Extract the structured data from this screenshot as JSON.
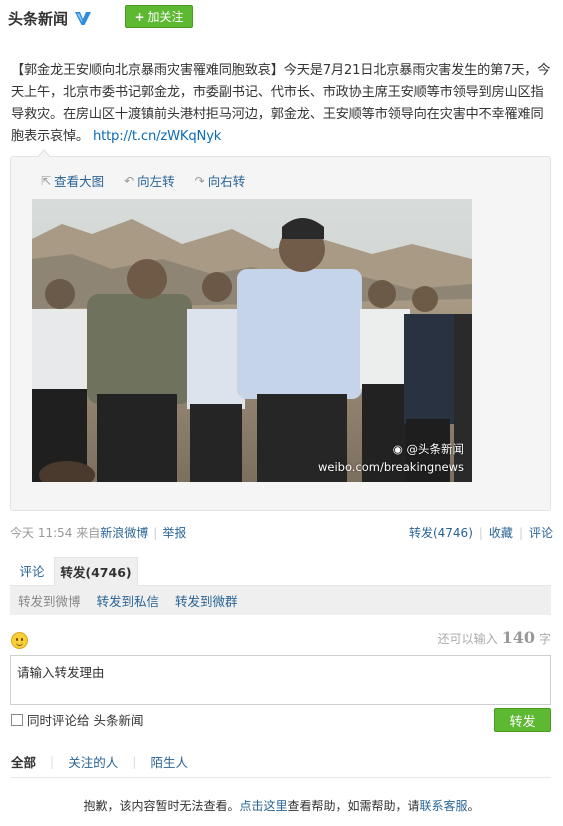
{
  "header": {
    "author": "头条新闻",
    "follow_label": "加关注"
  },
  "post": {
    "text": "【郭金龙王安顺向北京暴雨灾害罹难同胞致哀】今天是7月21日北京暴雨灾害发生的第7天，今天上午，北京市委书记郭金龙，市委副书记、代市长、市政协主席王安顺等市领导到房山区指导救灾。在房山区十渡镇前头港村拒马河边，郭金龙、王安顺等市领导向在灾害中不幸罹难同胞表示哀悼。",
    "link": "http://t.cn/zWKqNyk"
  },
  "image_tools": {
    "view_large": "查看大图",
    "rotate_left": "向左转",
    "rotate_right": "向右转"
  },
  "photo": {
    "watermark_logo": "@头条新闻",
    "watermark_url": "weibo.com/breakingnews"
  },
  "meta": {
    "time": "今天 11:54",
    "from_label": "来自",
    "source": "新浪微博",
    "report": "举报"
  },
  "actions": {
    "forward": "转发(4746)",
    "favorite": "收藏",
    "comment": "评论"
  },
  "tabs": {
    "comment": "评论",
    "forward": "转发(4746)"
  },
  "subtabs": {
    "to_weibo": "转发到微博",
    "to_message": "转发到私信",
    "to_group": "转发到微群"
  },
  "composer": {
    "remaining_prefix": "还可以输入",
    "remaining_count": "140",
    "remaining_suffix": "字",
    "textarea_value": "请输入转发理由",
    "also_comment": "同时评论给 头条新闻",
    "submit": "转发"
  },
  "filters": {
    "all": "全部",
    "following": "关注的人",
    "strangers": "陌生人"
  },
  "notice": {
    "prefix": "抱歉，该内容暂时无法查看。",
    "click_here": "点击这里",
    "middle": "查看帮助，如需帮助，请",
    "contact": "联系客服",
    "suffix": "。"
  },
  "colors": {
    "accent_green": "#5db832",
    "link_blue": "#2a6496",
    "verified_blue": "#2a8be0"
  },
  "icons": {
    "verified": "verified-v-icon",
    "view_large": "expand-icon",
    "rotate_left": "rotate-left-icon",
    "rotate_right": "rotate-right-icon",
    "emoji": "smiley-icon",
    "watermark": "weibo-logo-icon"
  }
}
